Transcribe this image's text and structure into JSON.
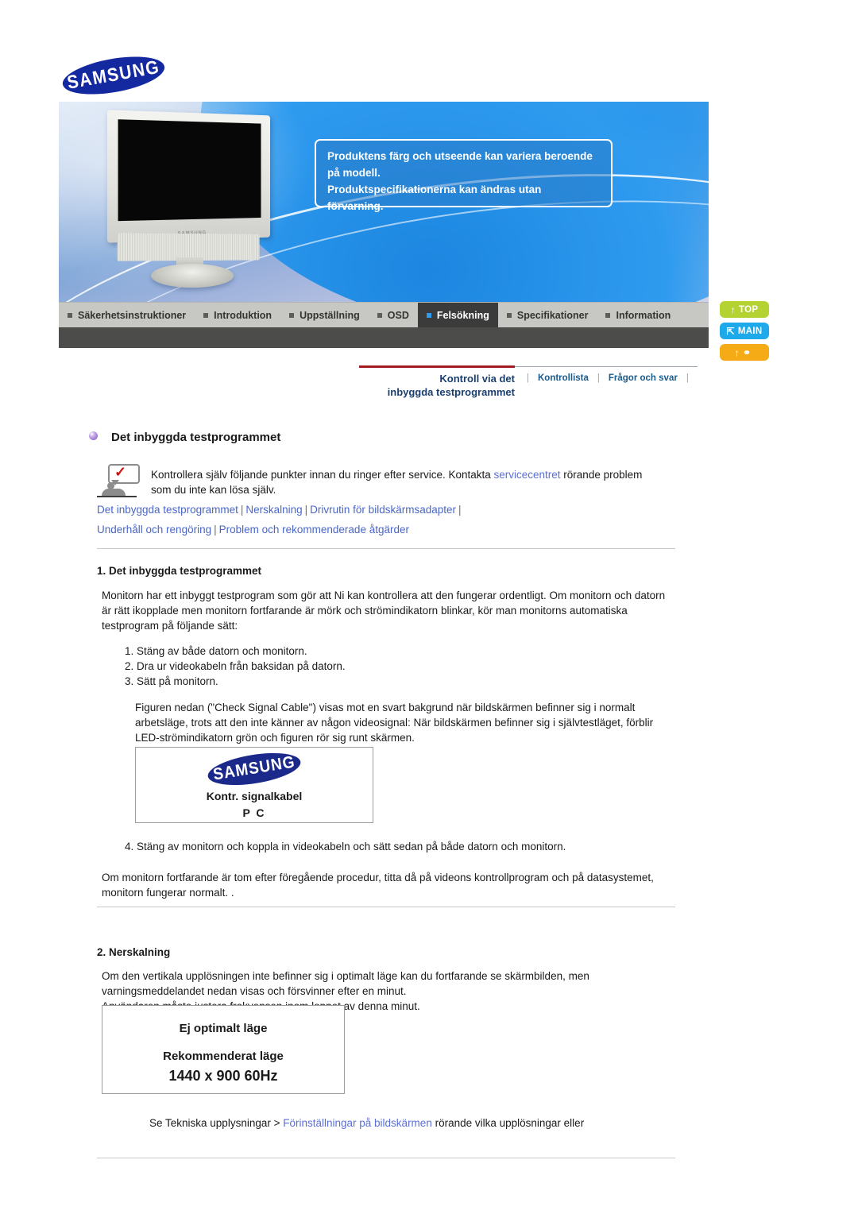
{
  "brand": {
    "logo_text": "SAMSUNG"
  },
  "banner": {
    "notice_lines": [
      "Produktens färg och utseende kan variera beroende",
      "på modell.",
      "Produktspecifikationerna kan ändras utan förvarning."
    ],
    "monitor_brand": "SAMSUNG"
  },
  "nav": {
    "items": [
      {
        "label": "Säkerhetsinstruktioner",
        "active": false
      },
      {
        "label": "Introduktion",
        "active": false
      },
      {
        "label": "Uppställning",
        "active": false
      },
      {
        "label": "OSD",
        "active": false
      },
      {
        "label": "Felsökning",
        "active": true
      },
      {
        "label": "Specifikationer",
        "active": false
      },
      {
        "label": "Information",
        "active": false
      }
    ]
  },
  "side_buttons": [
    {
      "label": "TOP",
      "glyph": "↑",
      "color": "#b4d333"
    },
    {
      "label": "MAIN",
      "glyph": "⇱",
      "color": "#1eaaea"
    },
    {
      "label": "",
      "glyph": "↑ ✇",
      "color": "#f5ab16"
    }
  ],
  "subnav": {
    "title_line1": "Kontroll via det",
    "title_line2": "inbyggda testprogrammet",
    "links": [
      {
        "label": "Kontrollista"
      },
      {
        "label": "Frågor och svar"
      }
    ],
    "separator": "|"
  },
  "page": {
    "heading": "Det inbyggda testprogrammet",
    "intro_before_link": "Kontrollera själv följande punkter innan du ringer efter service. Kontakta ",
    "intro_link": "servicecentret",
    "intro_after_link": " rörande problem som du inte kan lösa själv.",
    "quicklinks_row1": [
      "Det inbyggda testprogrammet",
      "Nerskalning",
      "Drivrutin för bildskärmsadapter"
    ],
    "quicklinks_row2": [
      "Underhåll och rengöring",
      "Problem och rekommenderade åtgärder"
    ],
    "section1": {
      "heading": "1. Det inbyggda testprogrammet",
      "paragraph": "Monitorn har ett inbyggt testprogram som gör att Ni kan kontrollera att den fungerar ordentligt. Om monitorn och datorn är rätt ikopplade men monitorn fortfarande är mörk och strömindikatorn blinkar, kör man monitorns automatiska testprogram på följande sätt:",
      "steps": [
        "Stäng av både datorn och monitorn.",
        "Dra ur videokabeln från baksidan på datorn.",
        "Sätt på monitorn."
      ],
      "paragraph2": "Figuren nedan (\"Check Signal Cable\") visas mot en svart bakgrund när bildskärmen befinner sig i normalt arbetsläge, trots att den inte känner av någon videosignal: När bildskärmen befinner sig i självtestläget, förblir LED-strömindikatorn grön och figuren rör sig runt skärmen.",
      "figure": {
        "logo": "SAMSUNG",
        "line1": "Kontr. signalkabel",
        "line2": "P C"
      },
      "step4": "Stäng av monitorn och koppla in videokabeln och sätt sedan på både datorn och monitorn.",
      "paragraph3": "Om monitorn fortfarande är tom efter föregående procedur, titta då på videons kontrollprogram och på datasystemet, monitorn fungerar normalt. ."
    },
    "section2": {
      "heading": "2. Nerskalning",
      "paragraph": "Om den vertikala upplösningen inte befinner sig i optimalt läge kan du fortfarande se skärmbilden, men varningsmeddelandet nedan visas och försvinner efter en minut.\nAnvändaren måste justera frekvensen inom loppet av denna minut.",
      "figure": {
        "line1": "Ej optimalt läge",
        "line2": "Rekommenderat läge",
        "line3": "1440 x 900 60Hz"
      },
      "footer_before_link": "Se Tekniska upplysningar > ",
      "footer_link": "Förinställningar på bildskärmen",
      "footer_after_link": " rörande vilka upplösningar eller"
    }
  }
}
